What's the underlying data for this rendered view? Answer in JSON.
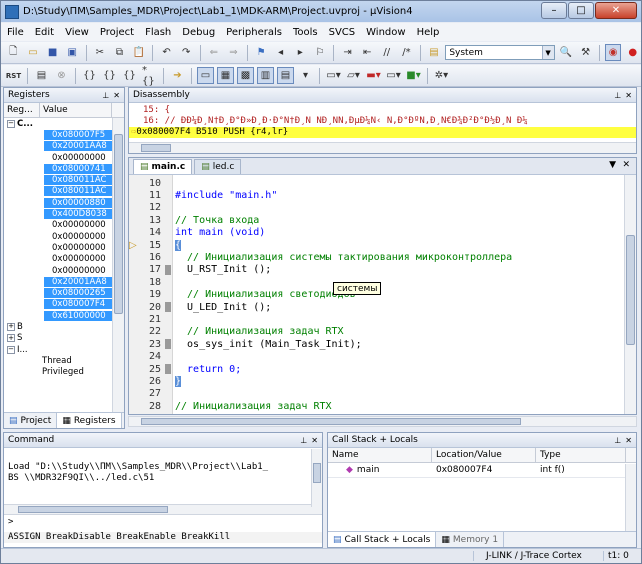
{
  "window": {
    "title": "D:\\Study\\ПМ\\Samples_MDR\\Project\\Lab1_1\\MDK-ARM\\Project.uvproj - µVision4"
  },
  "window_controls": {
    "minimize": "–",
    "maximize": "□",
    "close": "✕"
  },
  "menu": [
    "File",
    "Edit",
    "View",
    "Project",
    "Flash",
    "Debug",
    "Peripherals",
    "Tools",
    "SVCS",
    "Window",
    "Help"
  ],
  "toolbar1": {
    "target": "System"
  },
  "registers_panel": {
    "title": "Registers",
    "col_register": "Reg...",
    "col_value": "Value",
    "group_core": "C...",
    "values": [
      "0x080007F5",
      "0x20001AA8",
      "0x00000000",
      "0x08000741",
      "0x080011AC",
      "0x080011AC",
      "0x00000880",
      "0x400D8038",
      "0x00000000",
      "0x00000000",
      "0x00000000",
      "0x00000000",
      "0x00000000",
      "0x20001AA8",
      "0x08000265",
      "0x080007F4",
      "0x61000000"
    ],
    "selected_rows": [
      0,
      1,
      3,
      4,
      5,
      6,
      7,
      13,
      14,
      15,
      16
    ],
    "group_b": "B",
    "group_s": "S",
    "group_i": "I...",
    "mode_thread": "Thread",
    "mode_privileged": "Privileged",
    "tab_project": "Project",
    "tab_registers": "Registers"
  },
  "disassembly": {
    "title": "Disassembly",
    "line1": "    15: {",
    "line2": "    16:   // ÐÐ¼Ð¸Ñ†Ð¸Ð°Ð»Ð¸Ð·Ð°Ñ†Ð¸Ñ ÑÐ¸ÑÑ‚ÐµÐ¼Ñ‹ Ñ‚Ð°ÐºÑ‚Ð¸Ñ€Ð¾Ð²Ð°Ð½Ð¸Ñ Ð¼",
    "current": "0x080007F4 B510      PUSH     {r4,lr}"
  },
  "editor": {
    "tabs": [
      "main.c",
      "led.c"
    ],
    "lines": [
      {
        "n": "10",
        "t": ""
      },
      {
        "n": "11",
        "t": "#include \"main.h\""
      },
      {
        "n": "12",
        "t": ""
      },
      {
        "n": "13",
        "t": "// Точка входа"
      },
      {
        "n": "14",
        "t": "int main (void)"
      },
      {
        "n": "15",
        "t": "{"
      },
      {
        "n": "16",
        "t": "  // Инициализация системы тактирования микроконтроллера"
      },
      {
        "n": "17",
        "t": "  U_RST_Init ();"
      },
      {
        "n": "18",
        "t": ""
      },
      {
        "n": "19",
        "t": "  // Инициализация светодиодов"
      },
      {
        "n": "20",
        "t": "  U_LED_Init ();"
      },
      {
        "n": "21",
        "t": ""
      },
      {
        "n": "22",
        "t": "  // Инициализация задач RTX"
      },
      {
        "n": "23",
        "t": "  os_sys_init (Main_Task_Init);"
      },
      {
        "n": "24",
        "t": ""
      },
      {
        "n": "25",
        "t": "  return 0;"
      },
      {
        "n": "26",
        "t": "}"
      },
      {
        "n": "27",
        "t": ""
      },
      {
        "n": "28",
        "t": "// Инициализация задач RTX"
      }
    ],
    "tooltip": "системы"
  },
  "command_panel": {
    "title": "Command",
    "output_line1": "Load \"D:\\\\Study\\\\ПМ\\\\Samples_MDR\\\\Project\\\\Lab1_",
    "output_line2": "BS \\\\MDR32F9QI\\\\../led.c\\51",
    "prompt": ">",
    "hint": "ASSIGN BreakDisable BreakEnable BreakKill"
  },
  "callstack_panel": {
    "title": "Call Stack + Locals",
    "col_name": "Name",
    "col_location": "Location/Value",
    "col_type": "Type",
    "row_name": "main",
    "row_location": "0x080007F4",
    "row_type": "int f()",
    "tab_callstack": "Call Stack + Locals",
    "tab_memory": "Memory 1"
  },
  "statusbar": {
    "debugger": "J-LINK / J-Trace Cortex",
    "time": "t1: 0"
  }
}
